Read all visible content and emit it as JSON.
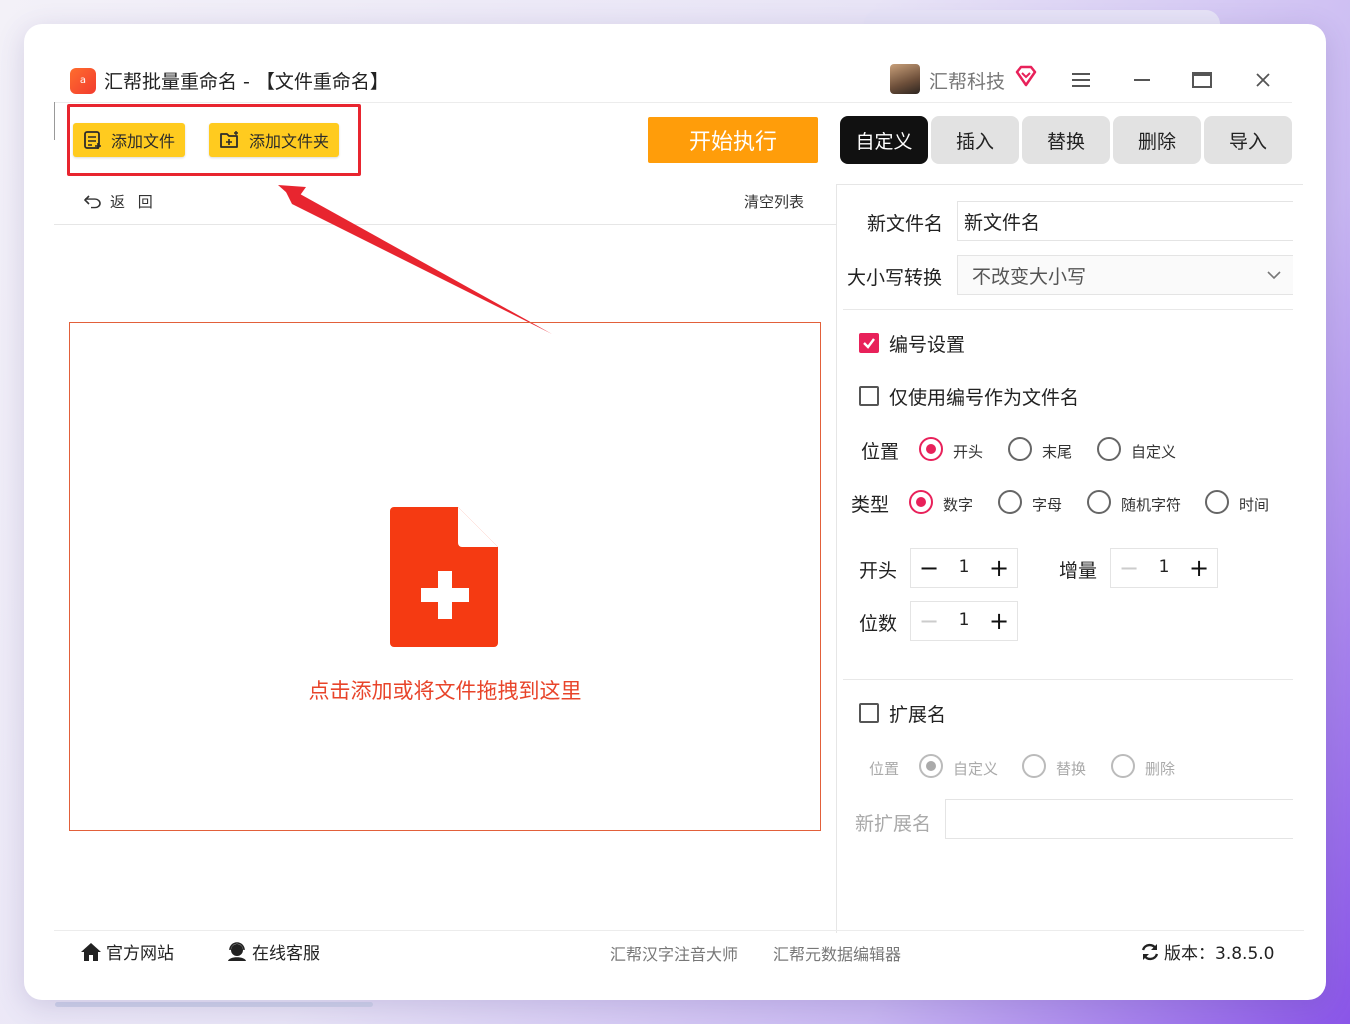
{
  "app": {
    "title": "汇帮批量重命名 - 【文件重命名】",
    "icon_text": "a",
    "user_name": "汇帮科技"
  },
  "toolbar": {
    "add_file": "添加文件",
    "add_folder": "添加文件夹",
    "start": "开始执行",
    "tabs": [
      "自定义",
      "插入",
      "替换",
      "删除",
      "导入"
    ],
    "active_tab": "自定义"
  },
  "list": {
    "back": "返 回",
    "clear": "清空列表",
    "drop_hint": "点击添加或将文件拖拽到这里"
  },
  "settings": {
    "new_name_label": "新文件名",
    "new_name_value": "新文件名",
    "case_label": "大小写转换",
    "case_value": "不改变大小写",
    "numbering_label": "编号设置",
    "numbering_checked": true,
    "only_number_label": "仅使用编号作为文件名",
    "only_number_checked": false,
    "position_label": "位置",
    "position_options": [
      "开头",
      "末尾",
      "自定义"
    ],
    "position_selected": "开头",
    "type_label": "类型",
    "type_options": [
      "数字",
      "字母",
      "随机字符",
      "时间"
    ],
    "type_selected": "数字",
    "start_label": "开头",
    "start_value": "1",
    "increment_label": "增量",
    "increment_value": "1",
    "digits_label": "位数",
    "digits_value": "1",
    "ext_label": "扩展名",
    "ext_checked": false,
    "ext_position_label": "位置",
    "ext_options": [
      "自定义",
      "替换",
      "删除"
    ],
    "ext_selected": "自定义",
    "new_ext_label": "新扩展名",
    "new_ext_value": ""
  },
  "footer": {
    "website": "官方网站",
    "support": "在线客服",
    "link1": "汇帮汉字注音大师",
    "link2": "汇帮元数据编辑器",
    "version": "版本：3.8.5.0"
  },
  "colors": {
    "accent_red": "#e8215a",
    "orange": "#ff9d0a",
    "yellow": "#ffcb1f",
    "drop_red": "#e8442a"
  }
}
